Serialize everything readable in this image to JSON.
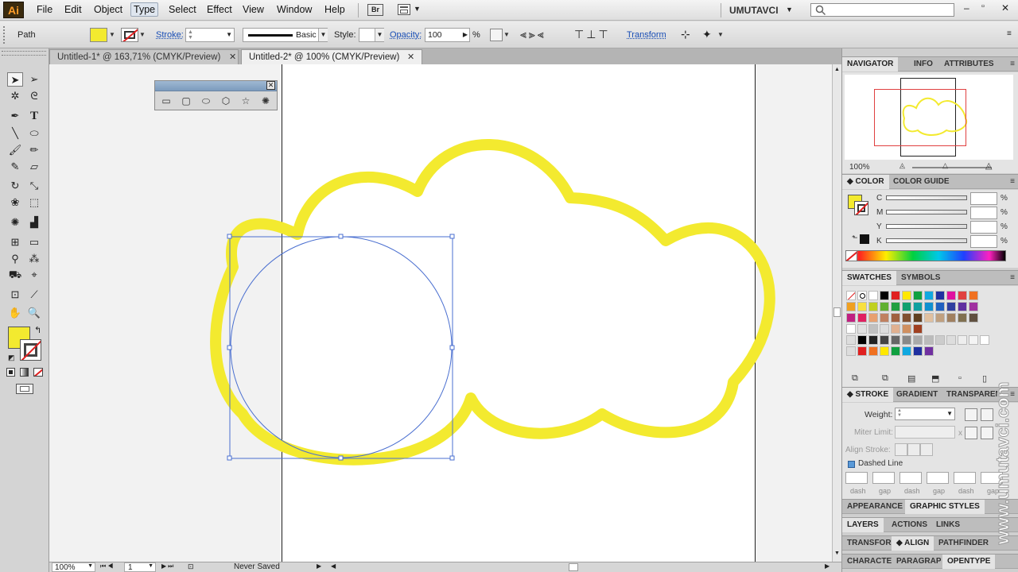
{
  "app": {
    "logo": "Ai",
    "user": "UMUTAVCI",
    "bridge_label": "Br"
  },
  "menu": [
    "File",
    "Edit",
    "Object",
    "Type",
    "Select",
    "Effect",
    "View",
    "Window",
    "Help"
  ],
  "hovered_menu": "Type",
  "control_bar": {
    "selection_type": "Path",
    "fill_color": "#f3ea2f",
    "stroke_label": "Stroke:",
    "brush_label": "Basic",
    "style_label": "Style:",
    "opacity_label": "Opacity:",
    "opacity_value": "100",
    "opacity_unit": "%",
    "transform_label": "Transform"
  },
  "tabs": [
    {
      "label": "Untitled-1* @ 163,71% (CMYK/Preview)",
      "active": false
    },
    {
      "label": "Untitled-2* @ 100% (CMYK/Preview)",
      "active": true
    }
  ],
  "tab_close": "✕",
  "status": {
    "zoom": "100%",
    "page": "1",
    "save_state": "Never Saved"
  },
  "navigator": {
    "tabs": [
      "NAVIGATOR",
      "INFO",
      "ATTRIBUTES"
    ],
    "zoom": "100%"
  },
  "color_panel": {
    "tabs": [
      "COLOR",
      "COLOR GUIDE"
    ],
    "channels": [
      "C",
      "M",
      "Y",
      "K"
    ],
    "percent": "%",
    "fill_color": "#f3ea2f"
  },
  "swatches_panel": {
    "tabs": [
      "SWATCHES",
      "SYMBOLS"
    ]
  },
  "stroke_panel": {
    "tabs": [
      "STROKE",
      "GRADIENT",
      "TRANSPARENCY"
    ],
    "weight_label": "Weight:",
    "miter_label": "Miter Limit:",
    "miter_unit": "x",
    "align_label": "Align Stroke:",
    "dashed_label": "Dashed Line",
    "dash_labels": [
      "dash",
      "gap",
      "dash",
      "gap",
      "dash",
      "gap"
    ]
  },
  "collapsed_panels": [
    [
      "APPEARANCE",
      "GRAPHIC STYLES"
    ],
    [
      "LAYERS",
      "ACTIONS",
      "LINKS"
    ],
    [
      "TRANSFORM",
      "ALIGN",
      "PATHFINDER"
    ],
    [
      "CHARACTER",
      "PARAGRAPH",
      "OPENTYPE"
    ]
  ],
  "watermark": "www.umutavci.com",
  "artwork": {
    "cloud_color": "#f3ea2f",
    "selection_color": "#4a6fd0"
  }
}
